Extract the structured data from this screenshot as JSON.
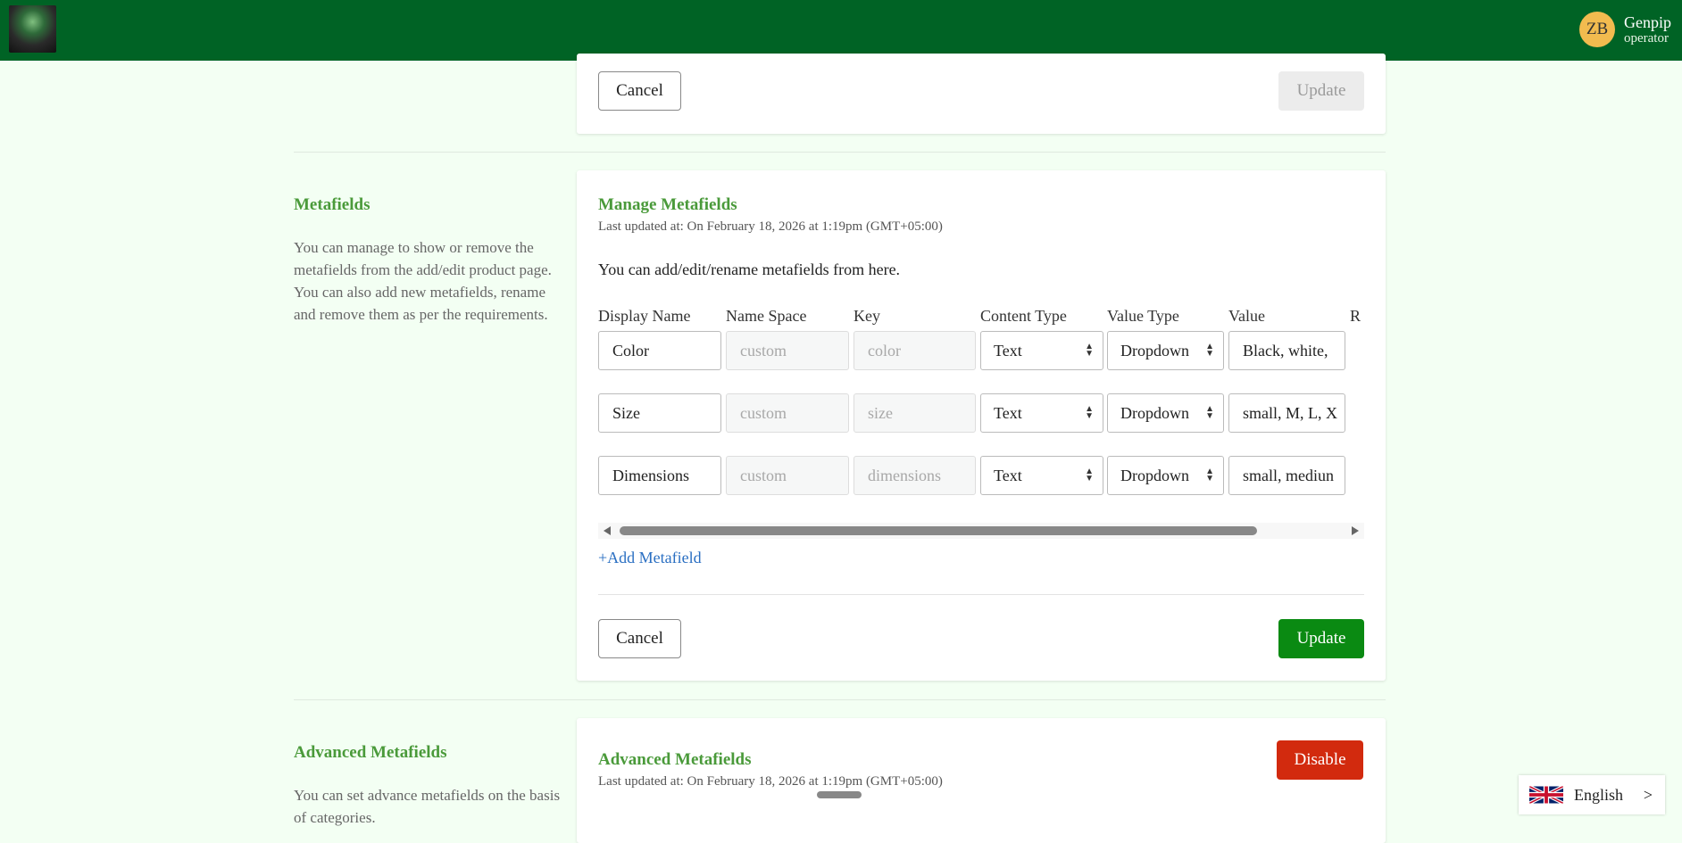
{
  "header": {
    "user_initials": "ZB",
    "user_name": "Genpip",
    "user_role": "operator"
  },
  "top_card": {
    "cancel_label": "Cancel",
    "update_label": "Update"
  },
  "metafields_section": {
    "side_title": "Metafields",
    "side_description": "You can manage to show or remove the metafields from the add/edit product page. You can also add new metafields, rename and remove them as per the requirements.",
    "card_title": "Manage Metafields",
    "last_updated": "Last updated at: On February 18, 2026 at 1:19pm (GMT+05:00)",
    "intro": "You can add/edit/rename metafields from here.",
    "columns": [
      "Display Name",
      "Name Space",
      "Key",
      "Content Type",
      "Value Type",
      "Value",
      "R"
    ],
    "rows": [
      {
        "display_name": "Color",
        "namespace": "custom",
        "key": "color",
        "content_type": "Text",
        "value_type": "Dropdown",
        "value": "Black, white,"
      },
      {
        "display_name": "Size",
        "namespace": "custom",
        "key": "size",
        "content_type": "Text",
        "value_type": "Dropdown",
        "value": "small, M, L, X"
      },
      {
        "display_name": "Dimensions",
        "namespace": "custom",
        "key": "dimensions",
        "content_type": "Text",
        "value_type": "Dropdown",
        "value": "small, mediun"
      }
    ],
    "add_label": "+Add Metafield",
    "cancel_label": "Cancel",
    "update_label": "Update"
  },
  "advanced_section": {
    "side_title": "Advanced Metafields",
    "side_description": "You can set advance metafields on the basis of categories.",
    "card_title": "Advanced Metafields",
    "last_updated": "Last updated at: On February 18, 2026 at 1:19pm (GMT+05:00)",
    "disable_label": "Disable"
  },
  "language": {
    "label": "English"
  },
  "colors": {
    "header_bg": "#006325",
    "accent_green": "#4a9a3a",
    "update_btn": "#0a8a12",
    "disable_btn": "#d22a0e",
    "link": "#2a6fc2",
    "page_bg": "#f3fff3"
  }
}
